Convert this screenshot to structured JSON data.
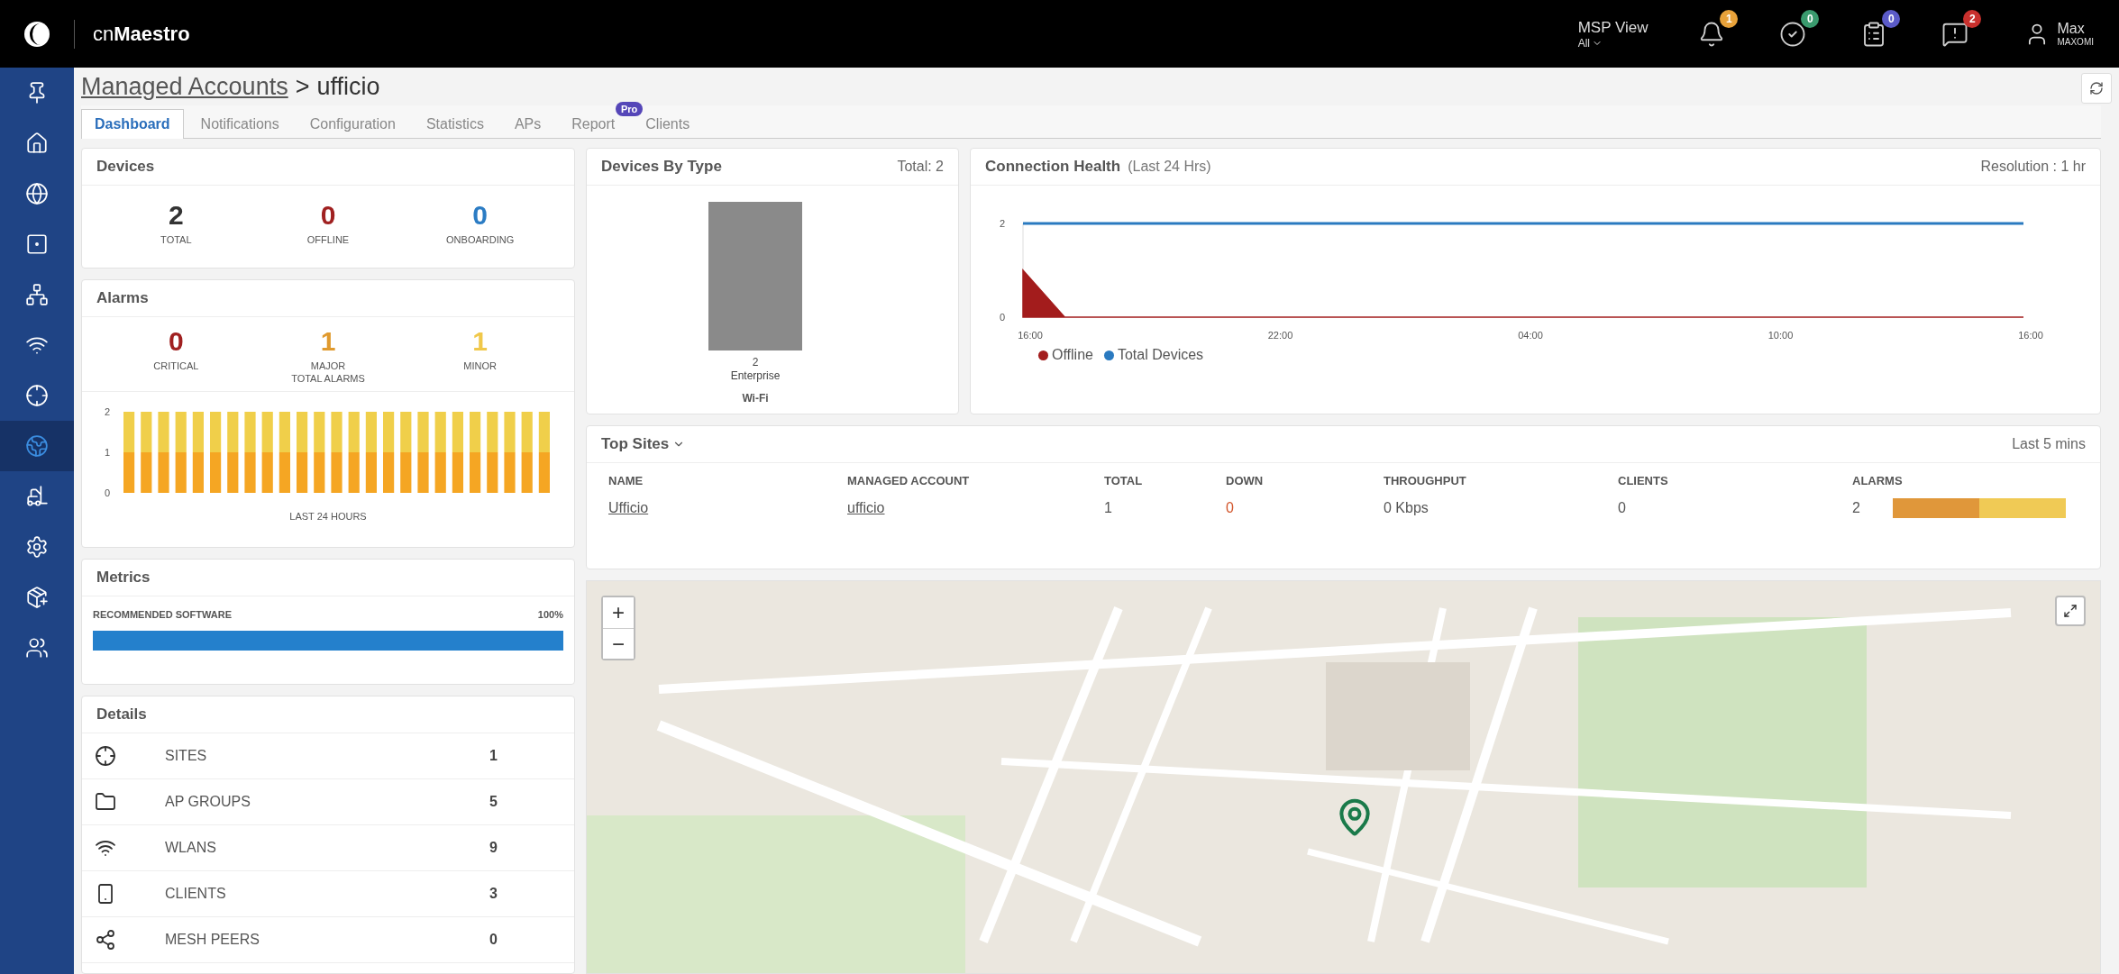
{
  "topbar": {
    "brand": "cn**Maestro**",
    "view_label": "MSP View",
    "view_value": "All",
    "notifications": [
      {
        "count": "1",
        "color": "#e8a23a"
      },
      {
        "count": "0",
        "color": "#3a9a6e"
      },
      {
        "count": "0",
        "color": "#5b5bc8"
      },
      {
        "count": "2",
        "color": "#c8302d"
      }
    ],
    "user_name": "Max",
    "user_org": "MAXOMI"
  },
  "sidebar": {
    "items": [
      {
        "selected": false
      },
      {
        "selected": false
      },
      {
        "selected": false
      },
      {
        "selected": false
      },
      {
        "selected": false
      },
      {
        "selected": false
      },
      {
        "selected": false
      },
      {
        "selected": true
      },
      {
        "selected": false
      },
      {
        "selected": false
      },
      {
        "selected": false
      },
      {
        "selected": false
      }
    ]
  },
  "breadcrumb": {
    "link": "Managed Accounts",
    "separator": ">",
    "current": "ufficio"
  },
  "tabs": [
    {
      "label": "Dashboard",
      "selected": true
    },
    {
      "label": "Notifications",
      "selected": false
    },
    {
      "label": "Configuration",
      "selected": false
    },
    {
      "label": "Statistics",
      "selected": false
    },
    {
      "label": "APs",
      "selected": false
    },
    {
      "label": "Report",
      "selected": false,
      "badge": "Pro"
    },
    {
      "label": "Clients",
      "selected": false
    }
  ],
  "devices": {
    "title": "Devices",
    "stats": [
      {
        "value": "2",
        "label": "TOTAL",
        "color": "#333333"
      },
      {
        "value": "0",
        "label": "OFFLINE",
        "color": "#a02020"
      },
      {
        "value": "0",
        "label": "ONBOARDING",
        "color": "#2b7cc4"
      }
    ]
  },
  "alarms": {
    "title": "Alarms",
    "stats": [
      {
        "value": "0",
        "label": "CRITICAL",
        "color": "#a02020"
      },
      {
        "value": "1",
        "label": "MAJOR",
        "color": "#e09a2e"
      },
      {
        "value": "1",
        "label": "MINOR",
        "color": "#f0c84a"
      }
    ],
    "total_label": "TOTAL ALARMS",
    "chart_data": {
      "type": "bar",
      "stacked": true,
      "xlabel": "LAST 24 HOURS",
      "ylim": [
        0,
        2
      ],
      "yticks": [
        0,
        1,
        2
      ],
      "series": [
        {
          "color": "#f5a623",
          "values": [
            1,
            1,
            1,
            1,
            1,
            1,
            1,
            1,
            1,
            1,
            1,
            1,
            1,
            1,
            1,
            1,
            1,
            1,
            1,
            1,
            1,
            1,
            1,
            1,
            1
          ]
        },
        {
          "color": "#f0cf4a",
          "values": [
            1,
            1,
            1,
            1,
            1,
            1,
            1,
            1,
            1,
            1,
            1,
            1,
            1,
            1,
            1,
            1,
            1,
            1,
            1,
            1,
            1,
            1,
            1,
            1,
            1
          ]
        }
      ]
    }
  },
  "metrics": {
    "title": "Metrics",
    "items": [
      {
        "label": "RECOMMENDED SOFTWARE",
        "reading": "100%",
        "level": 1
      }
    ]
  },
  "details": {
    "title": "Details",
    "rows": [
      {
        "label": "SITES",
        "value": "1"
      },
      {
        "label": "AP GROUPS",
        "value": "5"
      },
      {
        "label": "WLANS",
        "value": "9"
      },
      {
        "label": "CLIENTS",
        "value": "3"
      },
      {
        "label": "MESH PEERS",
        "value": "0"
      }
    ]
  },
  "devices_by_type": {
    "title": "Devices By Type",
    "total": "Total: 2",
    "bars": [
      {
        "count": "2",
        "category": "Enterprise"
      }
    ],
    "group_label": "Wi-Fi"
  },
  "connection_health": {
    "title": "Connection Health",
    "subtitle": "(Last 24 Hrs)",
    "resolution": "Resolution : 1 hr",
    "chart_data": {
      "type": "line",
      "categories": [
        "16:00",
        null,
        null,
        null,
        null,
        null,
        "22:00",
        null,
        null,
        null,
        null,
        null,
        "04:00",
        null,
        null,
        null,
        null,
        null,
        "10:00",
        null,
        null,
        null,
        null,
        null,
        "16:00"
      ],
      "ylim": [
        0,
        2
      ],
      "yticks": [
        0,
        2
      ],
      "series": [
        {
          "name": "Offline",
          "type": "area",
          "color": "#a31c1c",
          "values": [
            1,
            0,
            0,
            0,
            0,
            0,
            0,
            0,
            0,
            0,
            0,
            0,
            0,
            0,
            0,
            0,
            0,
            0,
            0,
            0,
            0,
            0,
            0,
            0,
            0
          ]
        },
        {
          "name": "Total Devices",
          "type": "line",
          "color": "#2a7ac0",
          "values": [
            2,
            2,
            2,
            2,
            2,
            2,
            2,
            2,
            2,
            2,
            2,
            2,
            2,
            2,
            2,
            2,
            2,
            2,
            2,
            2,
            2,
            2,
            2,
            2,
            2
          ]
        }
      ]
    }
  },
  "top_sites": {
    "title": "Top Sites",
    "period": "Last 5 mins",
    "columns": [
      "NAME",
      "MANAGED ACCOUNT",
      "TOTAL",
      "DOWN",
      "THROUGHPUT",
      "CLIENTS",
      "ALARMS"
    ],
    "rows": [
      {
        "name": "Ufficio",
        "account": "ufficio",
        "total": "1",
        "down": "0",
        "throughput": "0 Kbps",
        "clients": "0",
        "alarms": "2",
        "alarm_segments": [
          {
            "color": "#e0973a"
          },
          {
            "color": "#f0ca55"
          }
        ]
      }
    ]
  },
  "map": {
    "zoom_in": "+",
    "zoom_out": "−"
  }
}
